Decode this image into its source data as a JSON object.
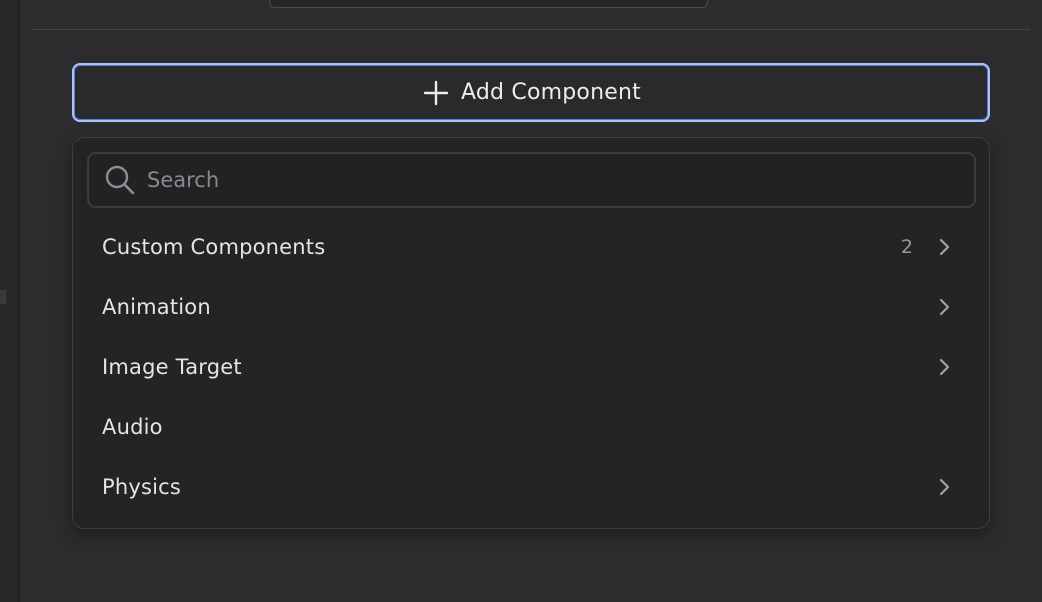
{
  "add_component": {
    "label": "Add Component",
    "icon": "plus-icon"
  },
  "search": {
    "placeholder": "Search",
    "value": "",
    "icon": "search-icon"
  },
  "menu": {
    "items": [
      {
        "label": "Custom Components",
        "count": "2",
        "has_submenu": true
      },
      {
        "label": "Animation",
        "count": "",
        "has_submenu": true
      },
      {
        "label": "Image Target",
        "count": "",
        "has_submenu": true
      },
      {
        "label": "Audio",
        "count": "",
        "has_submenu": false
      },
      {
        "label": "Physics",
        "count": "",
        "has_submenu": true
      }
    ]
  },
  "colors": {
    "background": "#2c2c2e",
    "dropdown_background": "#242426",
    "focus_ring": "#a9c3ff",
    "text": "#e4e4e6",
    "muted_text": "#8a8a8e"
  }
}
